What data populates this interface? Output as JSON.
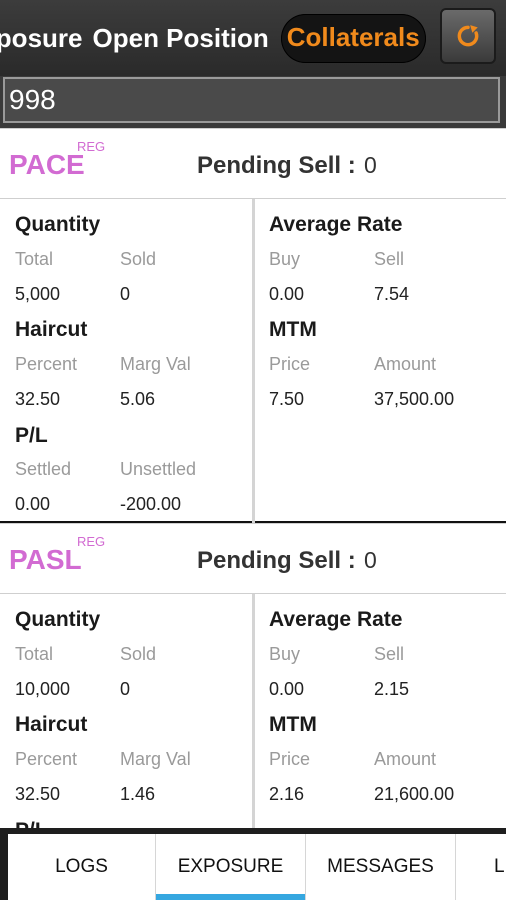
{
  "top_tabs": [
    {
      "label": "Exposure"
    },
    {
      "label": "Open Position"
    },
    {
      "label": "Collaterals",
      "active": true
    }
  ],
  "search": {
    "value": "998"
  },
  "labels": {
    "pending_sell": "Pending Sell :",
    "quantity": "Quantity",
    "total": "Total",
    "sold": "Sold",
    "haircut": "Haircut",
    "percent": "Percent",
    "marg_val": "Marg Val",
    "pl": "P/L",
    "settled": "Settled",
    "unsettled": "Unsettled",
    "average_rate": "Average Rate",
    "buy": "Buy",
    "sell": "Sell",
    "mtm": "MTM",
    "price": "Price",
    "amount": "Amount"
  },
  "items": [
    {
      "symbol": "PACE",
      "series": "REG",
      "pending_sell": "0",
      "quantity": {
        "total": "5,000",
        "sold": "0"
      },
      "haircut": {
        "percent": "32.50",
        "marg_val": "5.06"
      },
      "pl": {
        "settled": "0.00",
        "unsettled": "-200.00"
      },
      "average_rate": {
        "buy": "0.00",
        "sell": "7.54"
      },
      "mtm": {
        "price": "7.50",
        "amount": "37,500.00"
      }
    },
    {
      "symbol": "PASL",
      "series": "REG",
      "pending_sell": "0",
      "quantity": {
        "total": "10,000",
        "sold": "0"
      },
      "haircut": {
        "percent": "32.50",
        "marg_val": "1.46"
      },
      "pl": {
        "settled": "",
        "unsettled": ""
      },
      "average_rate": {
        "buy": "0.00",
        "sell": "2.15"
      },
      "mtm": {
        "price": "2.16",
        "amount": "21,600.00"
      }
    }
  ],
  "bottom_nav": [
    {
      "label": "LOGS"
    },
    {
      "label": "EXPOSURE",
      "active": true
    },
    {
      "label": "MESSAGES"
    },
    {
      "label": "L"
    }
  ],
  "colors": {
    "accent": "#f08a1c",
    "symbol": "#d26bd2",
    "nav_indicator": "#35a7e0"
  },
  "icons": {
    "refresh": "refresh-icon"
  }
}
